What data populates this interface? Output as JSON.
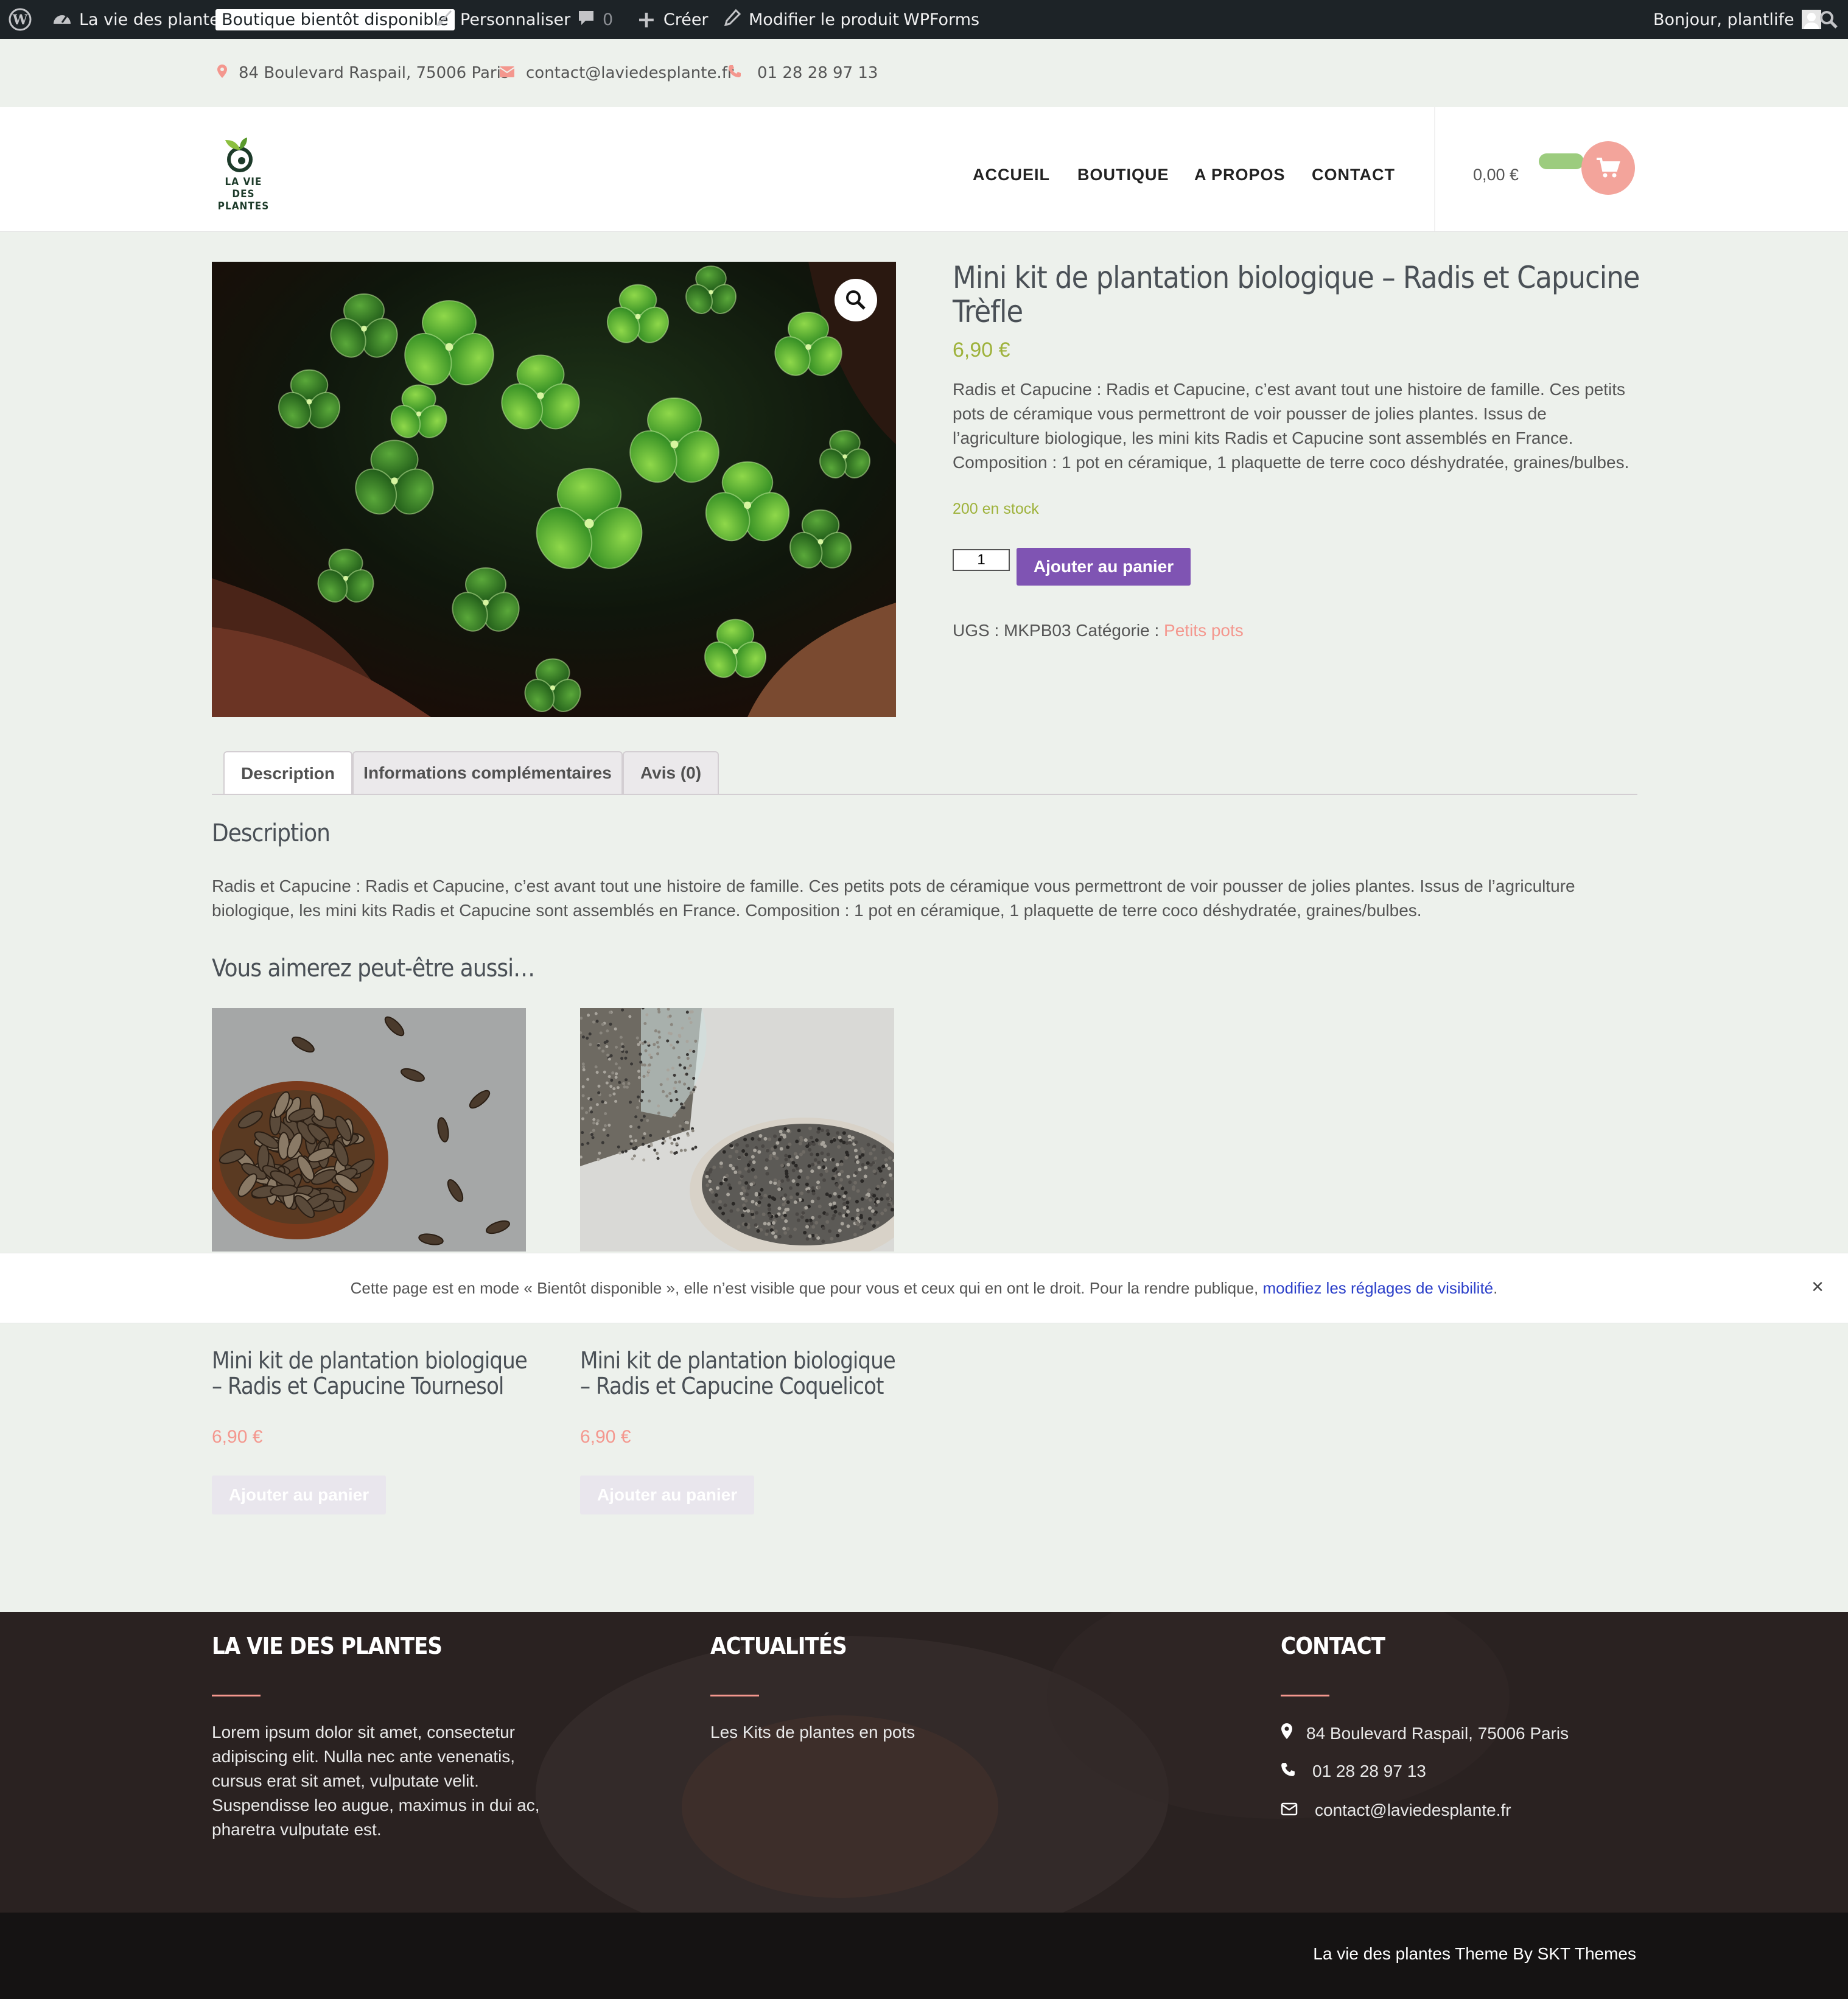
{
  "admin_bar": {
    "site_name": "La vie des plantes",
    "coming_soon_badge": "Boutique bientôt disponible",
    "customize": "Personnaliser",
    "comments_count": "0",
    "create": "Créer",
    "edit_product": "Modifier le produit",
    "wpforms": "WPForms",
    "greeting": "Bonjour, plantlife"
  },
  "info_bar": {
    "address": "84 Boulevard Raspail, 75006 Paris",
    "email": "contact@laviedesplante.fr",
    "phone": "01 28 28 97 13"
  },
  "header": {
    "logo_line1": "LA VIE DES",
    "logo_line2": "PLANTES",
    "nav": [
      "ACCUEIL",
      "BOUTIQUE",
      "A PROPOS",
      "CONTACT"
    ],
    "cart_total": "0,00 €"
  },
  "product": {
    "title": "Mini kit de plantation biologique – Radis et Capucine Trèfle",
    "price": "6,90 €",
    "short_description": "Radis et Capucine : Radis et Capucine, c’est avant tout une histoire de famille. Ces petits pots de céramique vous permettront de voir pousser de jolies plantes. Issus de l’agriculture biologique, les mini kits Radis et Capucine sont assemblés en France. Composition : 1 pot en céramique, 1 plaquette de terre coco déshydratée, graines/bulbes.",
    "stock": "200 en stock",
    "quantity": "1",
    "add_to_cart": "Ajouter au panier",
    "sku_label": "UGS : MKPB03 Catégorie :",
    "category": "Petits pots"
  },
  "tabs": [
    "Description",
    "Informations complémentaires",
    "Avis (0)"
  ],
  "description": {
    "heading": "Description",
    "text": "Radis et Capucine : Radis et Capucine, c’est avant tout une histoire de famille. Ces petits pots de céramique vous permettront de voir pousser de jolies plantes. Issus de l’agriculture biologique, les mini kits Radis et Capucine sont assemblés en France. Composition : 1 pot en céramique, 1 plaquette de terre coco déshydratée, graines/bulbes."
  },
  "related": {
    "heading": "Vous aimerez peut-être aussi…",
    "items": [
      {
        "title": "Mini kit de plantation biologique – Radis et Capucine Tournesol",
        "price": "6,90 €",
        "button": "Ajouter au panier"
      },
      {
        "title": "Mini kit de plantation biologique – Radis et Capucine Coquelicot",
        "price": "6,90 €",
        "button": "Ajouter au panier"
      }
    ]
  },
  "notice": {
    "text": "Cette page est en mode « Bientôt disponible », elle n’est visible que pour vous et ceux qui en ont le droit. Pour la rendre publique,",
    "link": "modifiez les réglages de visibilité",
    "end": ".",
    "close": "×"
  },
  "footer": {
    "col1_title": "LA VIE DES PLANTES",
    "col1_text": "Lorem ipsum dolor sit amet, consectetur adipiscing elit. Nulla nec ante venenatis, cursus erat sit amet, vulputate velit. Suspendisse leo augue, maximus in dui ac, pharetra vulputate est.",
    "col2_title": "ACTUALITÉS",
    "col2_link": "Les Kits de plantes en pots",
    "col3_title": "CONTACT",
    "address": "84 Boulevard Raspail, 75006 Paris",
    "phone": "01 28 28 97 13",
    "email": "contact@laviedesplante.fr",
    "credit": "La vie des plantes Theme By SKT Themes"
  },
  "colors": {
    "accent_pink": "#f4978e",
    "accent_green": "#9eb23b",
    "button_purple": "#7f54b3",
    "admin_bar": "#1d2327",
    "footer_bg": "#2a2221"
  }
}
